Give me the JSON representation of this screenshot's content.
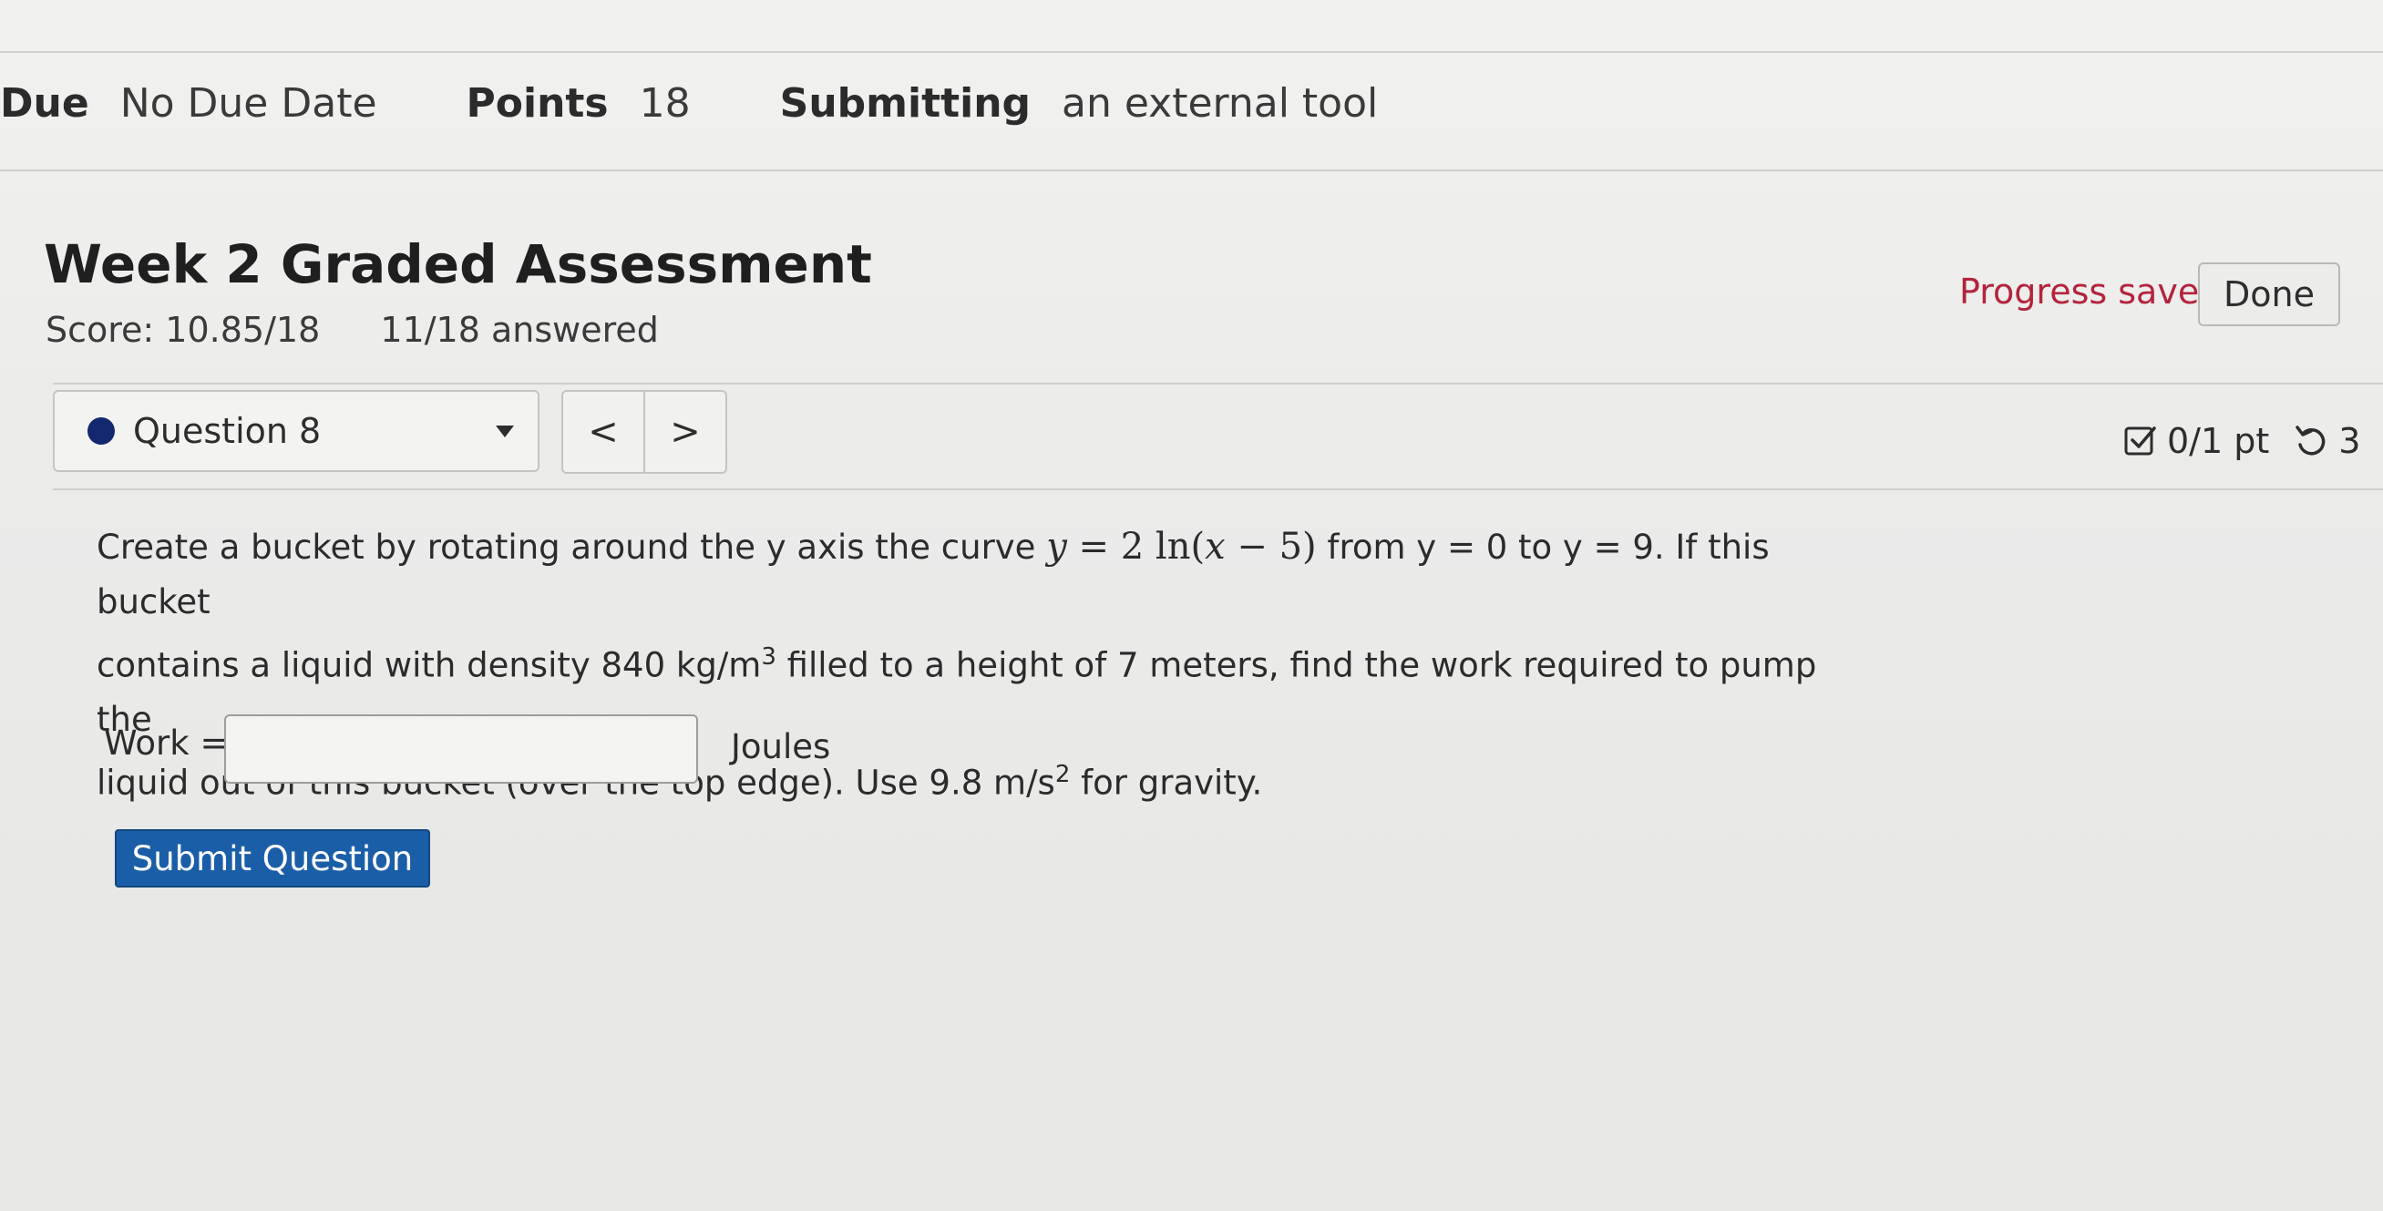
{
  "meta": {
    "due_label": "Due",
    "due_value": "No Due Date",
    "points_label": "Points",
    "points_value": "18",
    "submitting_label": "Submitting",
    "submitting_value": "an external tool"
  },
  "assessment": {
    "title": "Week 2 Graded Assessment",
    "score": "Score: 10.85/18",
    "answered": "11/18 answered"
  },
  "status": {
    "progress": "Progress saved",
    "done_label": "Done"
  },
  "question_nav": {
    "selected": "Question 8",
    "prev": "<",
    "next": ">",
    "points": "0/1 pt",
    "retries": "3"
  },
  "question": {
    "line1_a": "Create a bucket by rotating around the y axis the curve",
    "line1_b": "from y = 0 to y = 9. If this bucket",
    "line2_a": "contains a liquid with density 840 kg/m",
    "line2_b": "filled to a height of 7 meters, find the work required to pump the",
    "line3_a": "liquid out of this bucket (over the top edge). Use 9.8 m/s",
    "line3_b": "for gravity.",
    "cube": "3",
    "square": "2",
    "math_y": "y",
    "math_eq": " = 2 ln(",
    "math_x": "x",
    "math_rest": " − 5)"
  },
  "answer": {
    "label": "Work =",
    "value": "",
    "unit": "Joules"
  },
  "submit_label": "Submit Question",
  "colors": {
    "accent": "#1b5ea8",
    "progress": "#b3243c",
    "dot": "#13286e"
  }
}
